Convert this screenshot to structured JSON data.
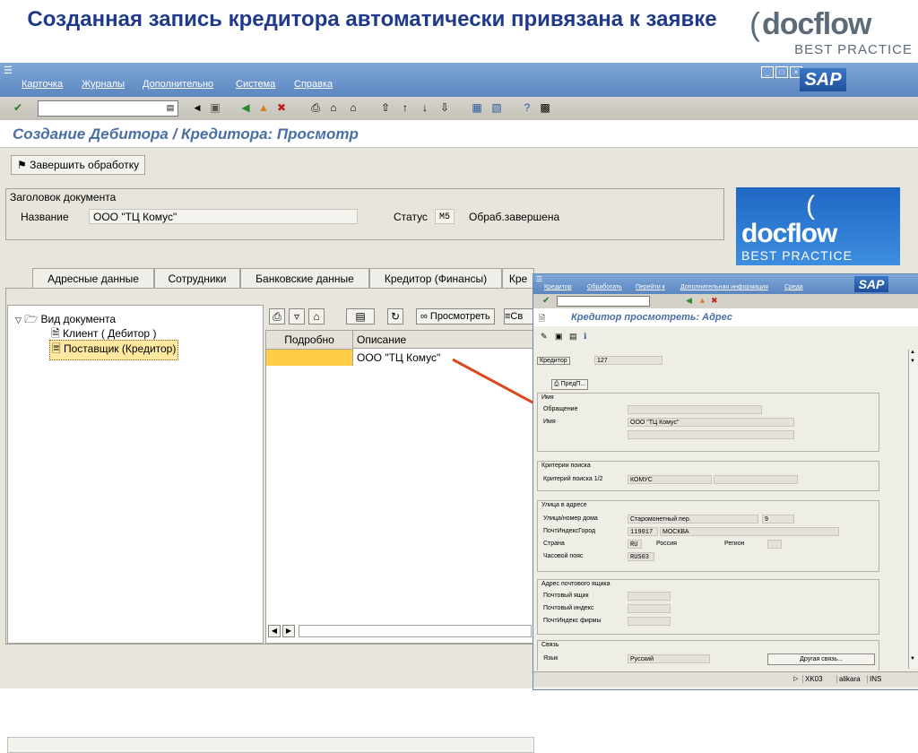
{
  "slide": {
    "title": "Созданная запись кредитора автоматически привязана к заявке",
    "logo": {
      "word": "docflow",
      "sub": "BEST PRACTICE"
    }
  },
  "menubar": {
    "items": [
      "Карточка",
      "Журналы",
      "Дополнительно",
      "Система",
      "Справка"
    ]
  },
  "toolbar": {
    "icons": [
      "enter-icon",
      "back-icon",
      "save-icon",
      "nav-back-icon",
      "exit-icon",
      "cancel-icon",
      "print-icon",
      "find-icon",
      "find-next-icon",
      "first-page-icon",
      "prev-page-icon",
      "next-page-icon",
      "last-page-icon",
      "new-session-icon",
      "shortcut-icon",
      "help-icon",
      "layout-icon"
    ]
  },
  "screen": {
    "title": "Создание Дебитора / Кредитора: Просмотр",
    "finish_button": "Завершить обработку"
  },
  "header_group": {
    "label": "Заголовок документа",
    "name_label": "Название",
    "name_value": "ООО \"ТЦ Комус\"",
    "status_label": "Статус",
    "status_code": "M5",
    "status_text": "Обраб.завершена"
  },
  "tabs": [
    "Адресные данные",
    "Сотрудники",
    "Банковские данные",
    "Кредитор (Финансы)",
    "Кре"
  ],
  "tree": {
    "root": "Вид документа",
    "children": [
      "Клиент ( Дебитор )",
      "Поставщик (Кредитор)"
    ]
  },
  "grid": {
    "toolbar_button": "Просмотреть",
    "toolbar_button2": "Св",
    "columns": [
      "Подробно",
      "Описание"
    ],
    "rows": [
      {
        "detail": "",
        "description": "ООО \"ТЦ Комус\""
      }
    ]
  },
  "popup": {
    "menu": [
      "Кредитор",
      "Обработать",
      "Перейти к",
      "Дополнительная информация",
      "Среда"
    ],
    "title": "Кредитор просмотреть: Адрес",
    "vendor_label": "Кредитор",
    "vendor_value": "127",
    "preview_button": "ПредП...",
    "groups": {
      "name": {
        "label": "Имя",
        "salutation_label": "Обращение",
        "name_label": "Имя",
        "name_value": "ООО \"ТЦ Комус\""
      },
      "search": {
        "label": "Критерии поиска",
        "term_label": "Критерий поиска 1/2",
        "term_value": "КОМУС"
      },
      "street": {
        "label": "Улица в адресе",
        "street_label": "Улица/номер дома",
        "street_value": "Старомонетный пер.",
        "house_value": "9",
        "city_label": "ПочтИндексГород",
        "zip_value": "119017",
        "city_value": "МОСКВА",
        "country_label": "Страна",
        "country_code": "RU",
        "country_name": "Россия",
        "region_label": "Регион",
        "tz_label": "Часовой пояс",
        "tz_value": "RUS03"
      },
      "pobox": {
        "label": "Адрес почтового ящика",
        "box_label": "Почтовый ящик",
        "zip_label": "Почтовый индекс",
        "company_zip_label": "ПочтИндекс фирмы"
      },
      "comm": {
        "label": "Связь",
        "lang_label": "Язык",
        "lang_value": "Русский",
        "other_button": "Другая связь..."
      }
    },
    "status": {
      "tcode": "XK03",
      "user": "alikara",
      "mode": "INS"
    }
  },
  "colors": {
    "slide_title": "#1f3a8a",
    "sap_blue": "#5b86c0",
    "arrow": "#d94a1e",
    "selection": "#ffcc44"
  }
}
